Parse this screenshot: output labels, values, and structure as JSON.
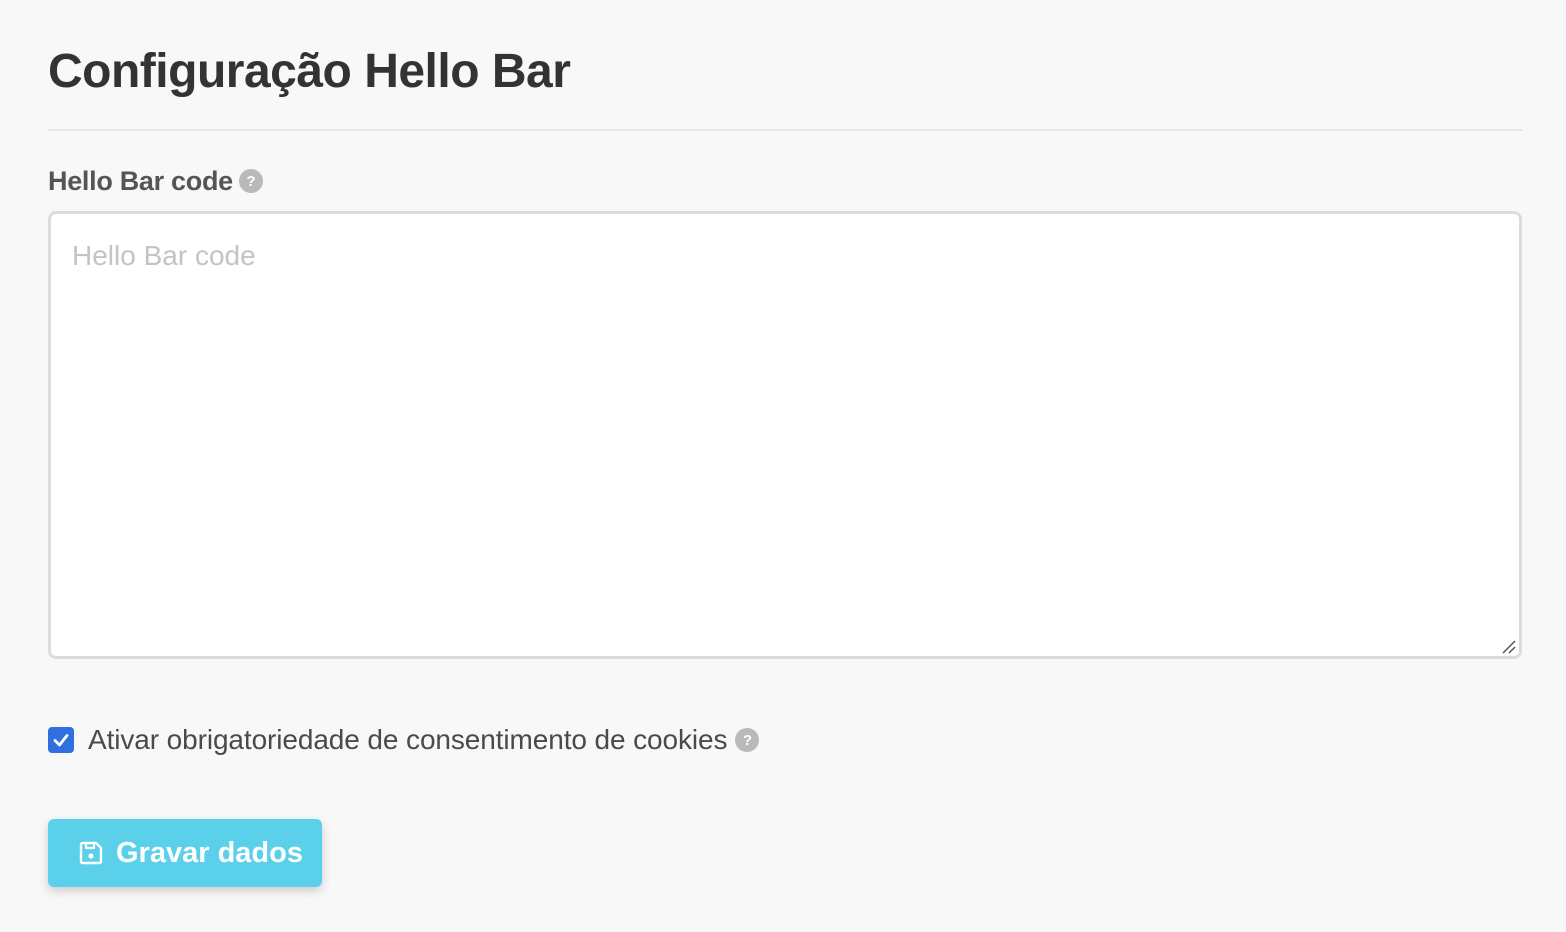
{
  "page": {
    "title": "Configuração Hello Bar"
  },
  "code_field": {
    "label": "Hello Bar code",
    "help_icon": "question-mark",
    "placeholder": "Hello Bar code",
    "value": ""
  },
  "cookie_consent": {
    "label": "Ativar obrigatoriedade de consentimento de cookies",
    "checked": true,
    "help_icon": "question-mark"
  },
  "actions": {
    "save_label": "Gravar dados",
    "save_icon": "floppy-disk-icon"
  },
  "colors": {
    "accent_button": "#5bd0ea",
    "checkbox": "#2f6fe0",
    "help_icon": "#b9b9b9"
  }
}
